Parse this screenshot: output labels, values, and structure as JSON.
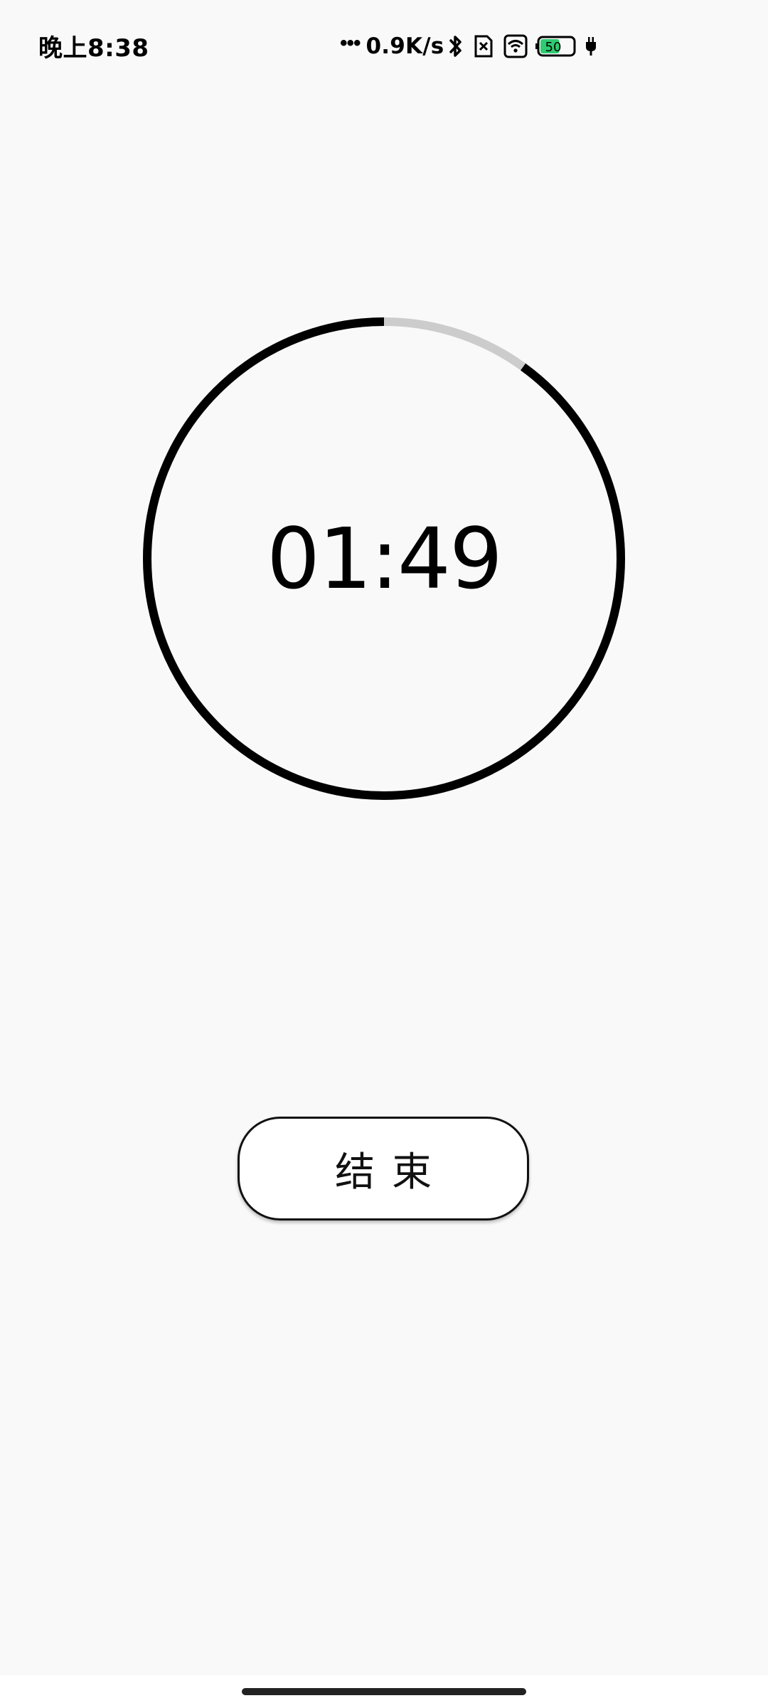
{
  "status_bar": {
    "time": "晚上8:38",
    "dots": "•••",
    "net_speed": "0.9K/s",
    "icons": [
      "bluetooth-icon",
      "sim-off-icon",
      "wifi-icon",
      "battery-icon",
      "charging-icon"
    ],
    "battery_level": "50",
    "battery_color": "#2ecc71"
  },
  "timer": {
    "display": "01:49",
    "remaining_fraction": 0.9,
    "ring_color": "#000000",
    "ring_track_color": "#cccccc"
  },
  "controls": {
    "end_label": "结束"
  }
}
